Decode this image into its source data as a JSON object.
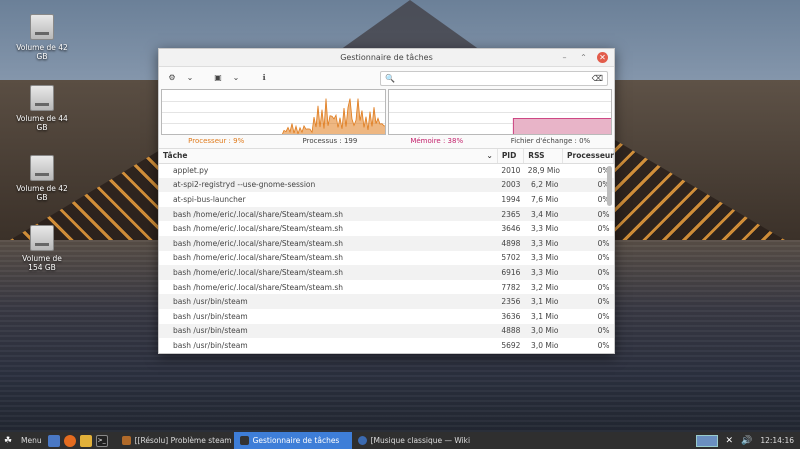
{
  "desktop": {
    "icons": [
      {
        "label": "Volume de 42 GB",
        "name": "desktop-volume-42gb-1"
      },
      {
        "label": "Volume de 44 GB",
        "name": "desktop-volume-44gb"
      },
      {
        "label": "Volume de 42 GB",
        "name": "desktop-volume-42gb-2"
      },
      {
        "label": "Volume de 154 GB",
        "name": "desktop-volume-154gb"
      }
    ]
  },
  "window": {
    "title": "Gestionnaire de tâches",
    "controls": {
      "minimize": "–",
      "maximize": "⌃",
      "close": "✕"
    }
  },
  "toolbar": {
    "settings_icon": "⚙",
    "dropdown": "⌄",
    "view_icon": "▣",
    "info_icon": "ℹ",
    "search": {
      "value": "",
      "placeholder": "",
      "search_icon": "🔍",
      "clear_icon": "⌫"
    }
  },
  "stats": {
    "cpu_label": "Processeur : 9%",
    "processes_label": "Processus : 199",
    "mem_label": "Mémoire : 38%",
    "swap_label": "Fichier d'échange : 0%",
    "cpu_percent": 9,
    "mem_percent": 38,
    "swap_percent": 0
  },
  "colors": {
    "cpu": "#e07b1c",
    "mem": "#c4226c",
    "mem_fill": "#e8b4c8"
  },
  "table": {
    "headers": {
      "task": "Tâche",
      "pid": "PID",
      "rss": "RSS",
      "cpu": "Processeur"
    },
    "rows": [
      {
        "task": "applet.py",
        "pid": "2010",
        "rss": "28,9 Mio",
        "cpu": "0%"
      },
      {
        "task": "at-spi2-registryd --use-gnome-session",
        "pid": "2003",
        "rss": "6,2 Mio",
        "cpu": "0%"
      },
      {
        "task": "at-spi-bus-launcher",
        "pid": "1994",
        "rss": "7,6 Mio",
        "cpu": "0%"
      },
      {
        "task": "bash /home/eric/.local/share/Steam/steam.sh",
        "pid": "2365",
        "rss": "3,4 Mio",
        "cpu": "0%"
      },
      {
        "task": "bash /home/eric/.local/share/Steam/steam.sh",
        "pid": "3646",
        "rss": "3,3 Mio",
        "cpu": "0%"
      },
      {
        "task": "bash /home/eric/.local/share/Steam/steam.sh",
        "pid": "4898",
        "rss": "3,3 Mio",
        "cpu": "0%"
      },
      {
        "task": "bash /home/eric/.local/share/Steam/steam.sh",
        "pid": "5702",
        "rss": "3,3 Mio",
        "cpu": "0%"
      },
      {
        "task": "bash /home/eric/.local/share/Steam/steam.sh",
        "pid": "6916",
        "rss": "3,3 Mio",
        "cpu": "0%"
      },
      {
        "task": "bash /home/eric/.local/share/Steam/steam.sh",
        "pid": "7782",
        "rss": "3,2 Mio",
        "cpu": "0%"
      },
      {
        "task": "bash /usr/bin/steam",
        "pid": "2356",
        "rss": "3,1 Mio",
        "cpu": "0%"
      },
      {
        "task": "bash /usr/bin/steam",
        "pid": "3636",
        "rss": "3,1 Mio",
        "cpu": "0%"
      },
      {
        "task": "bash /usr/bin/steam",
        "pid": "4888",
        "rss": "3,0 Mio",
        "cpu": "0%"
      },
      {
        "task": "bash /usr/bin/steam",
        "pid": "5692",
        "rss": "3,0 Mio",
        "cpu": "0%"
      }
    ]
  },
  "taskbar": {
    "menu_label": "Menu",
    "tasks": [
      {
        "label": "[[Résolu] Problème steam /...",
        "active": false
      },
      {
        "label": "Gestionnaire de tâches",
        "active": true
      },
      {
        "label": "[Musique classique — Wiki...",
        "active": false
      }
    ],
    "clock": "12:14:16"
  }
}
